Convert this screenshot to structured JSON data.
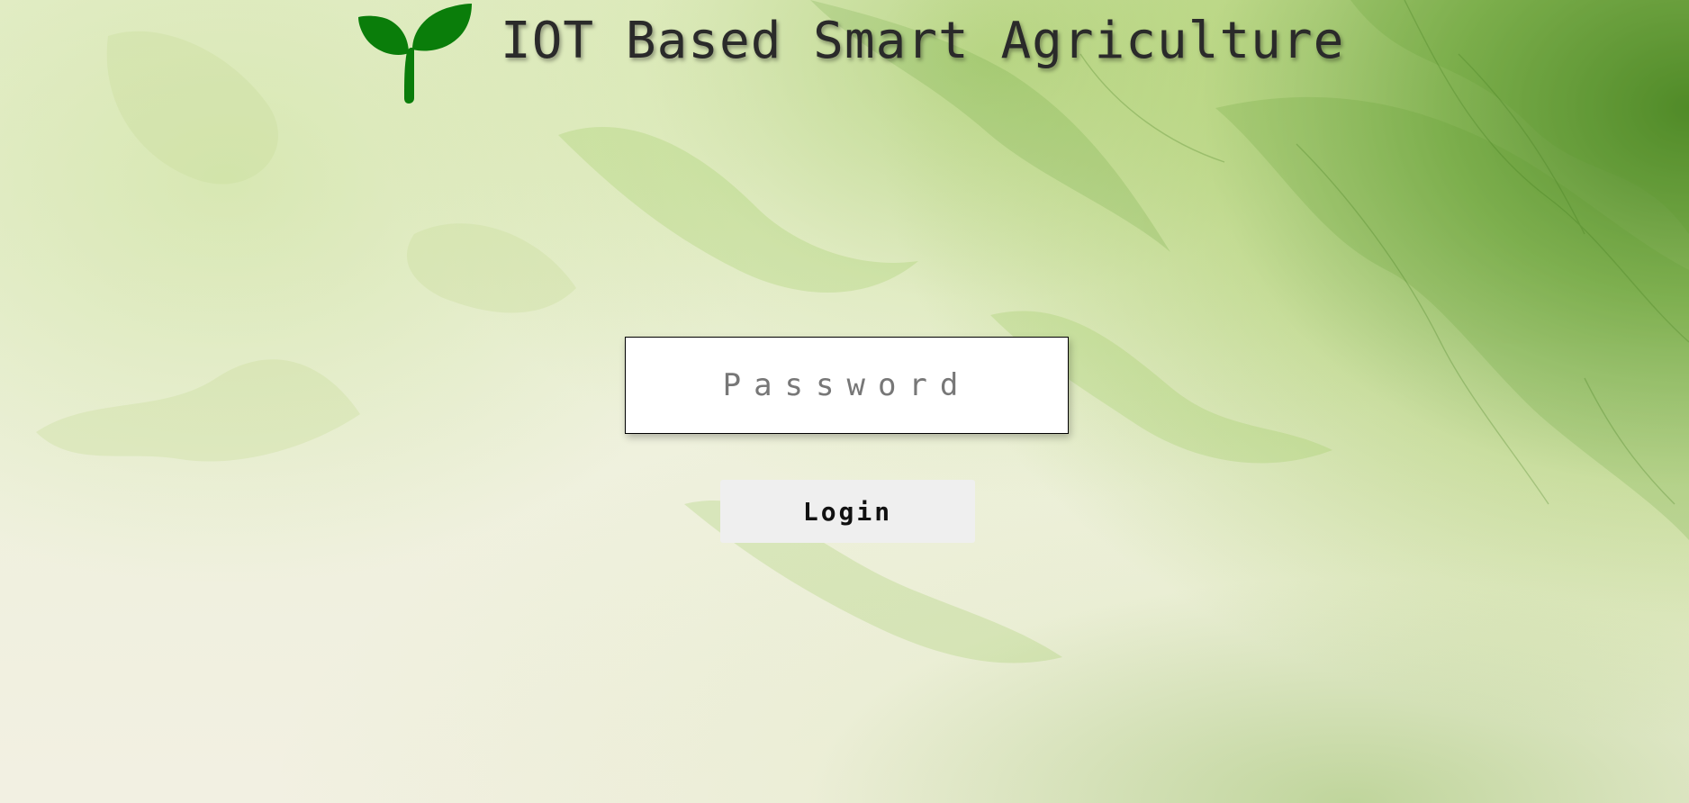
{
  "header": {
    "logo_icon": "sprout-icon",
    "logo_color": "#0a7d0a",
    "title": "IOT Based Smart Agriculture"
  },
  "login_form": {
    "password_placeholder": "Password",
    "password_value": "",
    "login_label": "Login"
  }
}
